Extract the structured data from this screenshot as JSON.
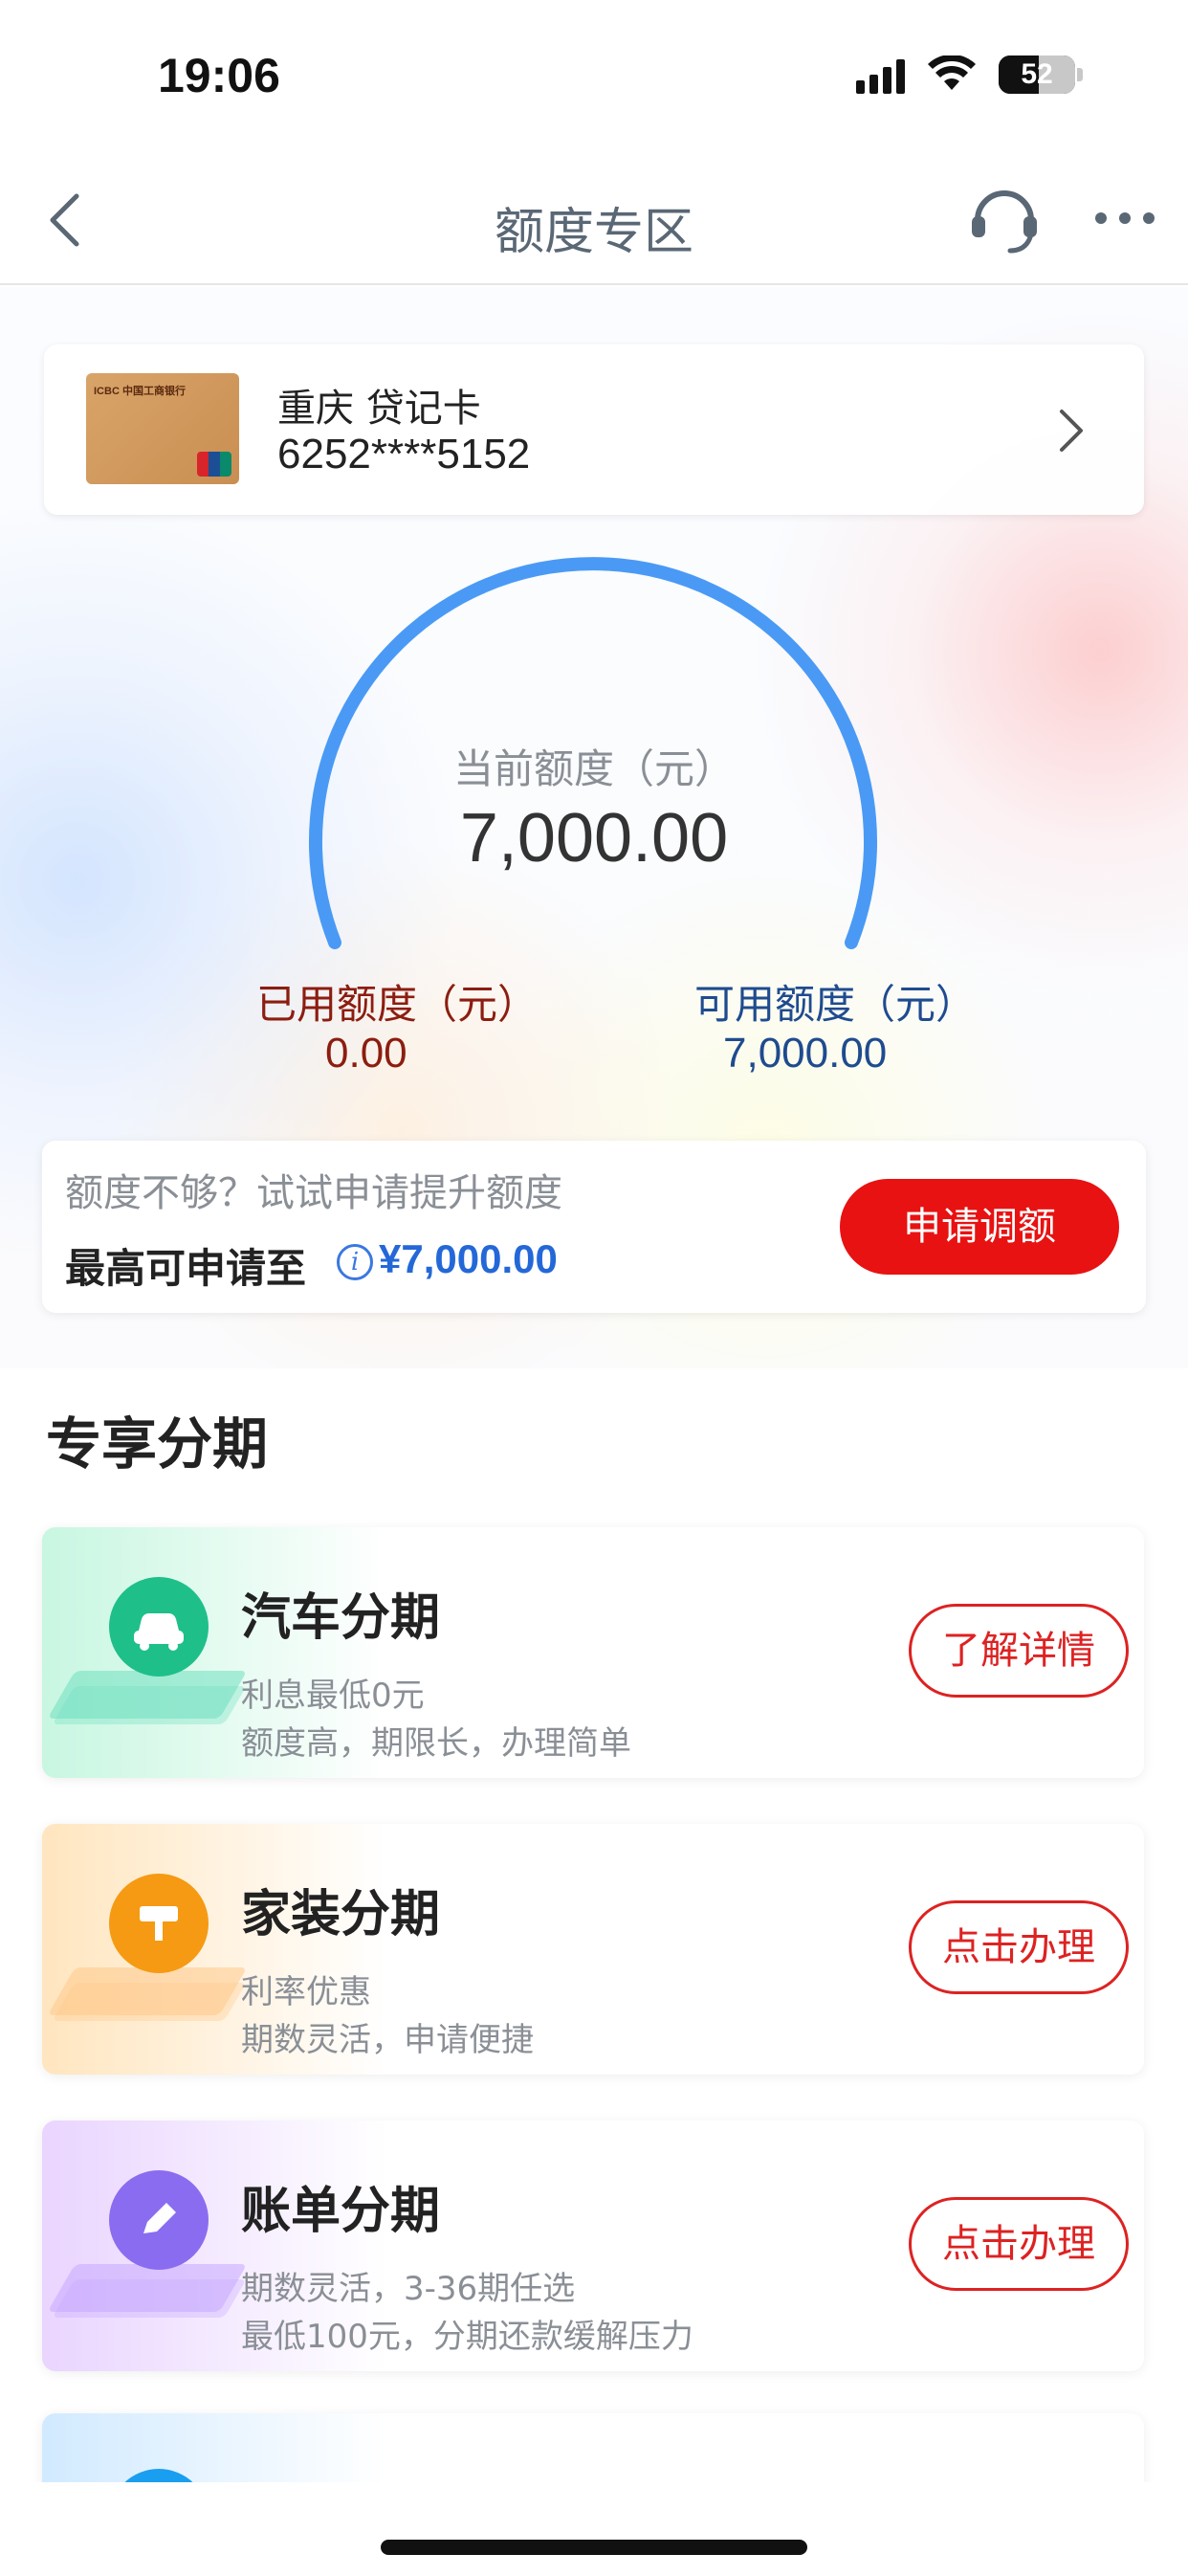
{
  "status_bar": {
    "time": "19:06",
    "battery_level": "52"
  },
  "nav": {
    "title": "额度专区",
    "icons": [
      "back-icon",
      "customer-service-icon",
      "more-icon"
    ]
  },
  "card": {
    "name": "重庆 贷记卡",
    "number": "6252****5152"
  },
  "limit": {
    "current_label": "当前额度（元）",
    "current_value": "7,000.00",
    "used_label": "已用额度（元）",
    "used_value": "0.00",
    "available_label": "可用额度（元）",
    "available_value": "7,000.00"
  },
  "increase": {
    "hint": "额度不够？试试申请提升额度",
    "max_label": "最高可申请至",
    "max_value": "¥7,000.00",
    "apply_label": "申请调额"
  },
  "section": {
    "title": "专享分期"
  },
  "installments": [
    {
      "title": "汽车分期",
      "line1": "利息最低0元",
      "line2": "额度高，期限长，办理简单",
      "button": "了解详情",
      "icon": "car-icon",
      "color": "#1fbf8a"
    },
    {
      "title": "家装分期",
      "line1": "利率优惠",
      "line2": "期数灵活，申请便捷",
      "button": "点击办理",
      "icon": "paint-roller-icon",
      "color": "#f59a12"
    },
    {
      "title": "账单分期",
      "line1": "期数灵活，3-36期任选",
      "line2": "最低100元，分期还款缓解压力",
      "button": "点击办理",
      "icon": "pencil-icon",
      "color": "#8a6cf0"
    }
  ],
  "colors": {
    "primary_red": "#e81212",
    "used_color": "#8c1d10",
    "available_color": "#1f4b8f",
    "gauge_blue": "#4a9af5"
  }
}
